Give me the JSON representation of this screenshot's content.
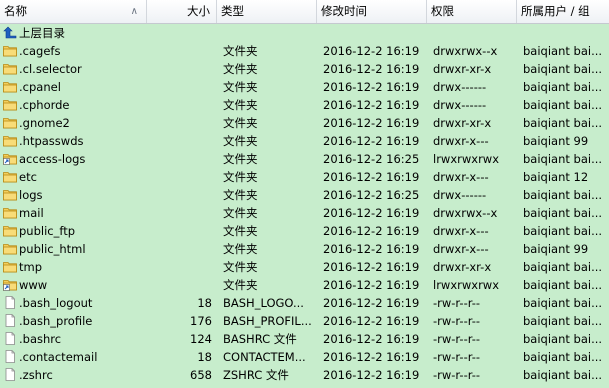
{
  "columns": {
    "name": "名称",
    "size": "大小",
    "type": "类型",
    "modified": "修改时间",
    "perms": "权限",
    "owner": "所属用户 / 组"
  },
  "parent_dir_label": "上层目录",
  "files": [
    {
      "name": ".cagefs",
      "size": "",
      "type": "文件夹",
      "modified": "2016-12-2 16:19",
      "perms": "drwxrwx--x",
      "owner": "baiqiant bai...",
      "kind": "folder"
    },
    {
      "name": ".cl.selector",
      "size": "",
      "type": "文件夹",
      "modified": "2016-12-2 16:19",
      "perms": "drwxr-xr-x",
      "owner": "baiqiant bai...",
      "kind": "folder"
    },
    {
      "name": ".cpanel",
      "size": "",
      "type": "文件夹",
      "modified": "2016-12-2 16:19",
      "perms": "drwx------",
      "owner": "baiqiant bai...",
      "kind": "folder"
    },
    {
      "name": ".cphorde",
      "size": "",
      "type": "文件夹",
      "modified": "2016-12-2 16:19",
      "perms": "drwx------",
      "owner": "baiqiant bai...",
      "kind": "folder"
    },
    {
      "name": ".gnome2",
      "size": "",
      "type": "文件夹",
      "modified": "2016-12-2 16:19",
      "perms": "drwxr-xr-x",
      "owner": "baiqiant bai...",
      "kind": "folder"
    },
    {
      "name": ".htpasswds",
      "size": "",
      "type": "文件夹",
      "modified": "2016-12-2 16:19",
      "perms": "drwxr-x---",
      "owner": "baiqiant 99",
      "kind": "folder"
    },
    {
      "name": "access-logs",
      "size": "",
      "type": "文件夹",
      "modified": "2016-12-2 16:25",
      "perms": "lrwxrwxrwx",
      "owner": "baiqiant bai...",
      "kind": "link"
    },
    {
      "name": "etc",
      "size": "",
      "type": "文件夹",
      "modified": "2016-12-2 16:19",
      "perms": "drwxr-x---",
      "owner": "baiqiant 12",
      "kind": "folder"
    },
    {
      "name": "logs",
      "size": "",
      "type": "文件夹",
      "modified": "2016-12-2 16:25",
      "perms": "drwx------",
      "owner": "baiqiant bai...",
      "kind": "folder"
    },
    {
      "name": "mail",
      "size": "",
      "type": "文件夹",
      "modified": "2016-12-2 16:19",
      "perms": "drwxrwx--x",
      "owner": "baiqiant bai...",
      "kind": "folder"
    },
    {
      "name": "public_ftp",
      "size": "",
      "type": "文件夹",
      "modified": "2016-12-2 16:19",
      "perms": "drwxr-x---",
      "owner": "baiqiant bai...",
      "kind": "folder"
    },
    {
      "name": "public_html",
      "size": "",
      "type": "文件夹",
      "modified": "2016-12-2 16:19",
      "perms": "drwxr-x---",
      "owner": "baiqiant 99",
      "kind": "folder"
    },
    {
      "name": "tmp",
      "size": "",
      "type": "文件夹",
      "modified": "2016-12-2 16:19",
      "perms": "drwxr-xr-x",
      "owner": "baiqiant bai...",
      "kind": "folder"
    },
    {
      "name": "www",
      "size": "",
      "type": "文件夹",
      "modified": "2016-12-2 16:19",
      "perms": "lrwxrwxrwx",
      "owner": "baiqiant bai...",
      "kind": "link"
    },
    {
      "name": ".bash_logout",
      "size": "18",
      "type": "BASH_LOGO...",
      "modified": "2016-12-2 16:19",
      "perms": "-rw-r--r--",
      "owner": "baiqiant bai...",
      "kind": "file"
    },
    {
      "name": ".bash_profile",
      "size": "176",
      "type": "BASH_PROFIL...",
      "modified": "2016-12-2 16:19",
      "perms": "-rw-r--r--",
      "owner": "baiqiant bai...",
      "kind": "file"
    },
    {
      "name": ".bashrc",
      "size": "124",
      "type": "BASHRC 文件",
      "modified": "2016-12-2 16:19",
      "perms": "-rw-r--r--",
      "owner": "baiqiant bai...",
      "kind": "file"
    },
    {
      "name": ".contactemail",
      "size": "18",
      "type": "CONTACTEM...",
      "modified": "2016-12-2 16:19",
      "perms": "-rw-r--r--",
      "owner": "baiqiant bai...",
      "kind": "file"
    },
    {
      "name": ".zshrc",
      "size": "658",
      "type": "ZSHRC 文件",
      "modified": "2016-12-2 16:19",
      "perms": "-rw-r--r--",
      "owner": "baiqiant bai...",
      "kind": "file"
    }
  ]
}
